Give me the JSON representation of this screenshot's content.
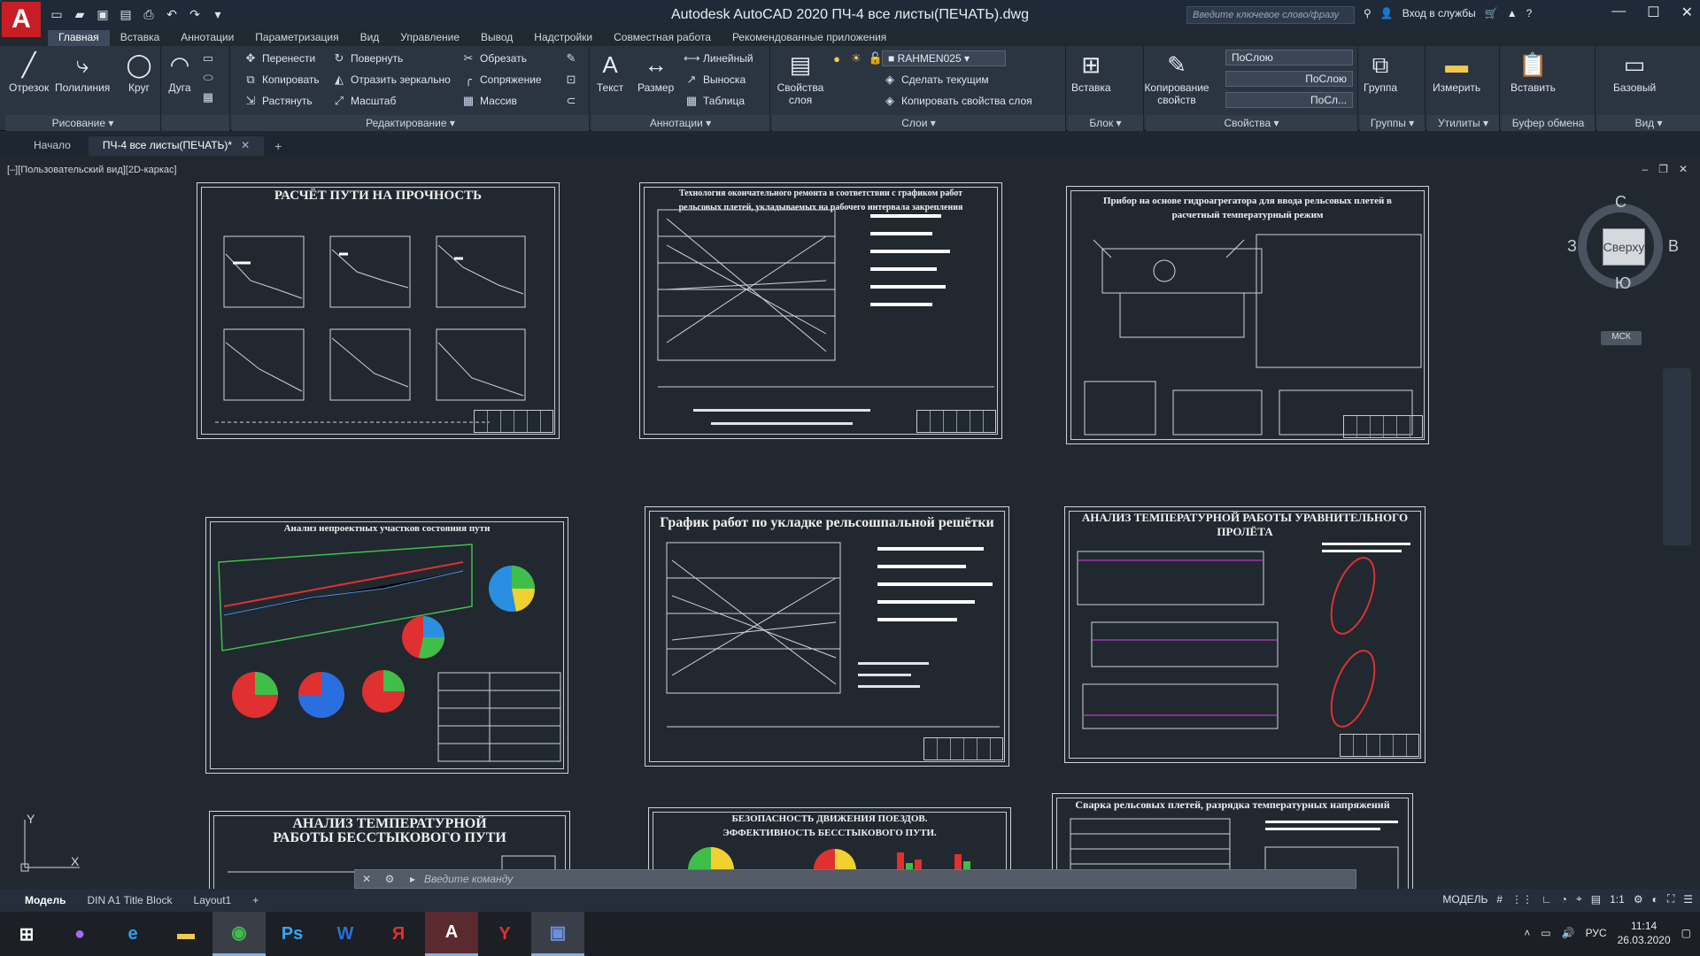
{
  "title_bar": {
    "title": "Autodesk AutoCAD 2020    ПЧ-4  все листы(ПЕЧАТЬ).dwg",
    "search_placeholder": "Введите ключевое слово/фразу",
    "sign_in": "Вход в службы",
    "logo": "A"
  },
  "ribbon_tabs": [
    "Главная",
    "Вставка",
    "Аннотации",
    "Параметризация",
    "Вид",
    "Управление",
    "Вывод",
    "Надстройки",
    "Совместная работа",
    "Рекомендованные приложения"
  ],
  "ribbon": {
    "draw": {
      "title": "Рисование",
      "line": "Отрезок",
      "polyline": "Полилиния",
      "circle": "Круг",
      "arc": "Дуга"
    },
    "modify": {
      "title": "Редактирование",
      "move": "Перенести",
      "rotate": "Повернуть",
      "trim": "Обрезать",
      "copy": "Копировать",
      "mirror": "Отразить зеркально",
      "fillet": "Сопряжение",
      "stretch": "Растянуть",
      "scale": "Масштаб",
      "array": "Массив"
    },
    "annotation": {
      "title": "Аннотации",
      "text": "Текст",
      "dimension": "Размер",
      "linear": "Линейный",
      "leader": "Выноска",
      "table": "Таблица"
    },
    "layers": {
      "title": "Слои",
      "properties": "Свойства слоя",
      "layer_name": "RAHMEN025",
      "make_current": "Сделать текущим",
      "match_layer": "Копировать свойства слоя"
    },
    "block": {
      "title": "Блок",
      "insert": "Вставка"
    },
    "properties": {
      "title": "Свойства",
      "match": "Копирование свойств",
      "color": "ПоСлою",
      "linetype": "ПоСлою",
      "lineweight": "ПоСл..."
    },
    "groups": {
      "title": "Группы",
      "group": "Группа"
    },
    "utilities": {
      "title": "Утилиты",
      "measure": "Измерить"
    },
    "clipboard": {
      "title": "Буфер обмена",
      "paste": "Вставить"
    },
    "view": {
      "title": "Вид",
      "base": "Базовый"
    }
  },
  "doc_tabs": {
    "start": "Начало",
    "active": "ПЧ-4  все листы(ПЕЧАТЬ)*"
  },
  "viewport_label": "[–][Пользовательский вид][2D-каркас]",
  "viewcube": {
    "top": "Сверху",
    "north": "С",
    "south": "Ю",
    "east": "В",
    "west": "З",
    "wcs": "МСК"
  },
  "sheets": [
    {
      "title": "РАСЧЁТ ПУТИ НА ПРОЧНОСТЬ"
    },
    {
      "title": "Технология окончательного ремонта в соответствии с графиком работ рельсовых плетей, укладываемых на рабочего интервала закрепления"
    },
    {
      "title": "Прибор на основе гидроагрегатора для ввода рельсовых плетей в расчетный температурный режим"
    },
    {
      "title": "Анализ непроектных участков состояния пути"
    },
    {
      "title": "График работ по укладке рельсошпальной решётки"
    },
    {
      "title": "АНАЛИЗ ТЕМПЕРАТУРНОЙ РАБОТЫ УРАВНИТЕЛЬНОГО ПРОЛЁТА"
    },
    {
      "title": "АНАЛИЗ ТЕМПЕРАТУРНОЙ РАБОТЫ БЕССТЫКОВОГО ПУТИ"
    },
    {
      "title": "БЕЗОПАСНОСТЬ ДВИЖЕНИЯ ПОЕЗДОВ. ЭФФЕКТИВНОСТЬ БЕССТЫКОВОГО ПУТИ."
    },
    {
      "title": "Сварка рельсовых плетей, разрядка температурных напряжений"
    }
  ],
  "command_placeholder": "Введите команду",
  "layout_tabs": [
    "Модель",
    "DIN A1 Title Block",
    "Layout1"
  ],
  "status": {
    "model": "МОДЕЛЬ",
    "scale": "1:1"
  },
  "tray": {
    "lang": "РУС",
    "time": "11:14",
    "date": "26.03.2020"
  }
}
